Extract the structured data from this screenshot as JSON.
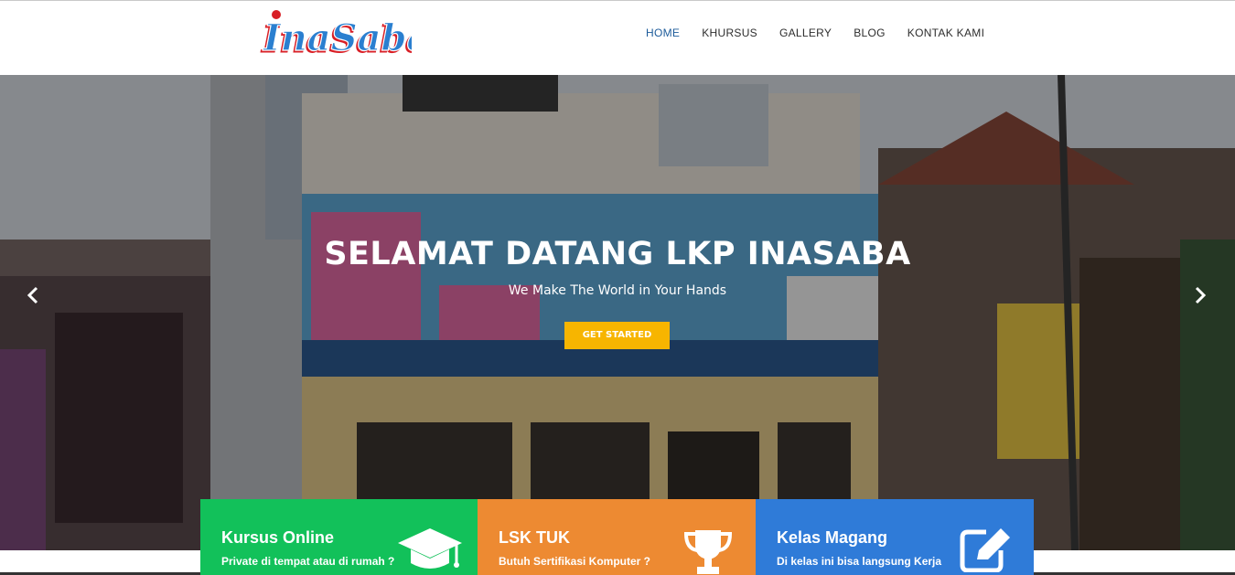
{
  "brand": {
    "logo_text": "InaSaba"
  },
  "nav": {
    "items": [
      {
        "label": "HOME",
        "active": true
      },
      {
        "label": "KHURSUS",
        "active": false
      },
      {
        "label": "GALLERY",
        "active": false
      },
      {
        "label": "BLOG",
        "active": false
      },
      {
        "label": "KONTAK KAMI",
        "active": false
      }
    ]
  },
  "hero": {
    "title": "SELAMAT DATANG LKP INASABA",
    "subtitle": "We Make The World in Your Hands",
    "cta_label": "GET STARTED",
    "prev_icon": "chevron-left-icon",
    "next_icon": "chevron-right-icon"
  },
  "features": [
    {
      "title": "Kursus Online",
      "text": "Private di tempat atau di rumah ?",
      "icon": "graduation-cap-icon",
      "color": "#12c15a"
    },
    {
      "title": "LSK TUK",
      "text": "Butuh Sertifikasi Komputer ?",
      "icon": "trophy-icon",
      "color": "#ed8a32"
    },
    {
      "title": "Kelas Magang",
      "text": "Di kelas ini bisa langsung Kerja",
      "icon": "edit-icon",
      "color": "#2f7bd8"
    }
  ],
  "colors": {
    "accent": "#f7b500",
    "nav_active": "#1c5b9a"
  }
}
